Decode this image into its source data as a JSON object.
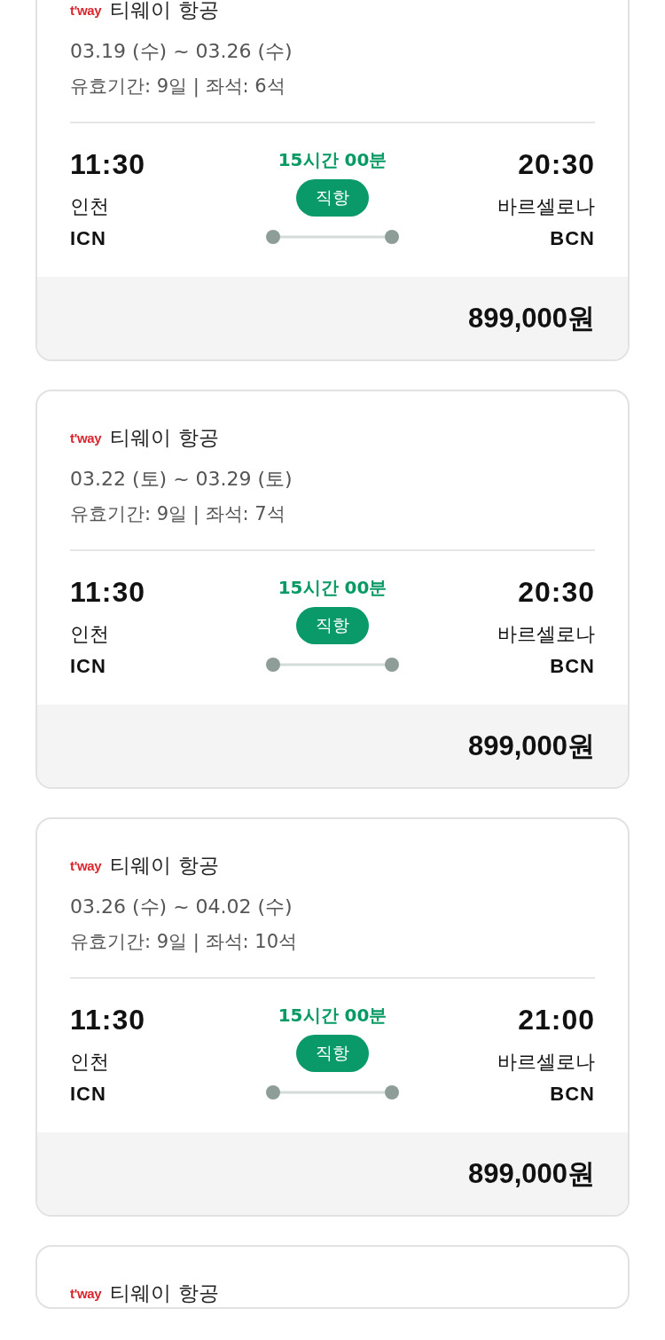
{
  "flights": [
    {
      "logo": "t'way",
      "airline": "티웨이 항공",
      "dates": "03.19 (수) ~ 03.26 (수)",
      "validity": "유효기간: 9일 | 좌석: 6석",
      "depart_time": "11:30",
      "depart_city": "인천",
      "depart_code": "ICN",
      "duration": "15시간 00분",
      "route_type": "직항",
      "arrive_time": "20:30",
      "arrive_city": "바르셀로나",
      "arrive_code": "BCN",
      "price": "899,000원"
    },
    {
      "logo": "t'way",
      "airline": "티웨이 항공",
      "dates": "03.22 (토) ~ 03.29 (토)",
      "validity": "유효기간: 9일 | 좌석: 7석",
      "depart_time": "11:30",
      "depart_city": "인천",
      "depart_code": "ICN",
      "duration": "15시간 00분",
      "route_type": "직항",
      "arrive_time": "20:30",
      "arrive_city": "바르셀로나",
      "arrive_code": "BCN",
      "price": "899,000원"
    },
    {
      "logo": "t'way",
      "airline": "티웨이 항공",
      "dates": "03.26 (수) ~ 04.02 (수)",
      "validity": "유효기간: 9일 | 좌석: 10석",
      "depart_time": "11:30",
      "depart_city": "인천",
      "depart_code": "ICN",
      "duration": "15시간 00분",
      "route_type": "직항",
      "arrive_time": "21:00",
      "arrive_city": "바르셀로나",
      "arrive_code": "BCN",
      "price": "899,000원"
    },
    {
      "logo": "t'way",
      "airline": "티웨이 항공"
    }
  ]
}
